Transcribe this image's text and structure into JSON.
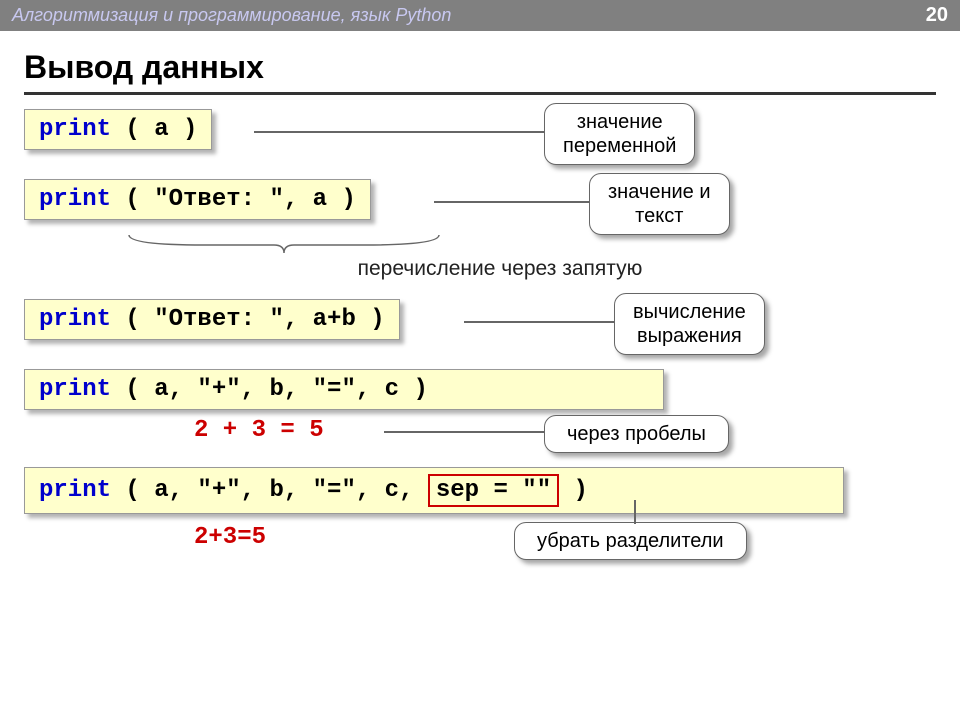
{
  "header": {
    "title": "Алгоритмизация и программирование, язык Python",
    "page_number": "20"
  },
  "main_title": "Вывод данных",
  "rows": {
    "r1": {
      "code_print": "print",
      "code_rest": " ( a )",
      "callout": "значение\nпеременной"
    },
    "r2": {
      "code_print": "print",
      "code_rest": " ( \"Ответ: \", a )",
      "callout": "значение и\nтекст"
    },
    "note_enum": "перечисление через запятую",
    "r3": {
      "code_print": "print",
      "code_rest": " ( \"Ответ: \", a+b )",
      "callout": "вычисление\nвыражения"
    },
    "r4": {
      "code_print": "print",
      "code_rest": " ( a, \"+\", b, \"=\", c )"
    },
    "output1": "2 + 3 = 5",
    "callout_spaces": "через пробелы",
    "r5": {
      "code_print": "print",
      "code_part1": " ( a, \"+\", b, \"=\", c, ",
      "code_sep": "sep = \"\"",
      "code_part2": " )"
    },
    "output2": "2+3=5",
    "callout_remove": "убрать разделители"
  }
}
